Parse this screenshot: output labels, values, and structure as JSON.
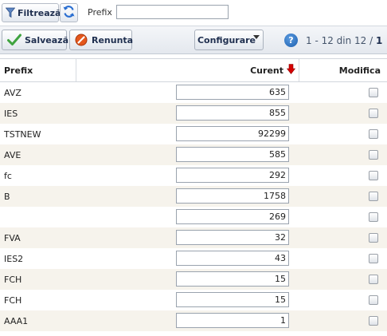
{
  "filter_bar": {
    "filter_label": "Filtrează",
    "prefix_label": "Prefix",
    "prefix_value": ""
  },
  "toolbar": {
    "save_label": "Salvează",
    "cancel_label": "Renunta",
    "config_label": "Configurare",
    "help_glyph": "?",
    "pager_range": "1 - 12 din 12 /",
    "pager_page": "1"
  },
  "grid": {
    "headers": {
      "prefix": "Prefix",
      "curent": "Curent",
      "modifica": "Modifica"
    },
    "rows": [
      {
        "prefix": "AVZ",
        "curent": "635"
      },
      {
        "prefix": "IES",
        "curent": "855"
      },
      {
        "prefix": "TSTNEW",
        "curent": "92299"
      },
      {
        "prefix": "AVE",
        "curent": "585"
      },
      {
        "prefix": "fc",
        "curent": "292"
      },
      {
        "prefix": "B",
        "curent": "1758"
      },
      {
        "prefix": "",
        "curent": "269"
      },
      {
        "prefix": "FVA",
        "curent": "32"
      },
      {
        "prefix": "IES2",
        "curent": "43"
      },
      {
        "prefix": "FCH",
        "curent": "15"
      },
      {
        "prefix": "FCH",
        "curent": "15"
      },
      {
        "prefix": "AAA1",
        "curent": "1"
      }
    ]
  },
  "colors": {
    "sort_arrow": "#d40000",
    "save_check": "#3fa33f",
    "cancel_icon": "#e4571c",
    "row_alt": "#f6f3ec",
    "help_icon": "#1d5fae"
  }
}
